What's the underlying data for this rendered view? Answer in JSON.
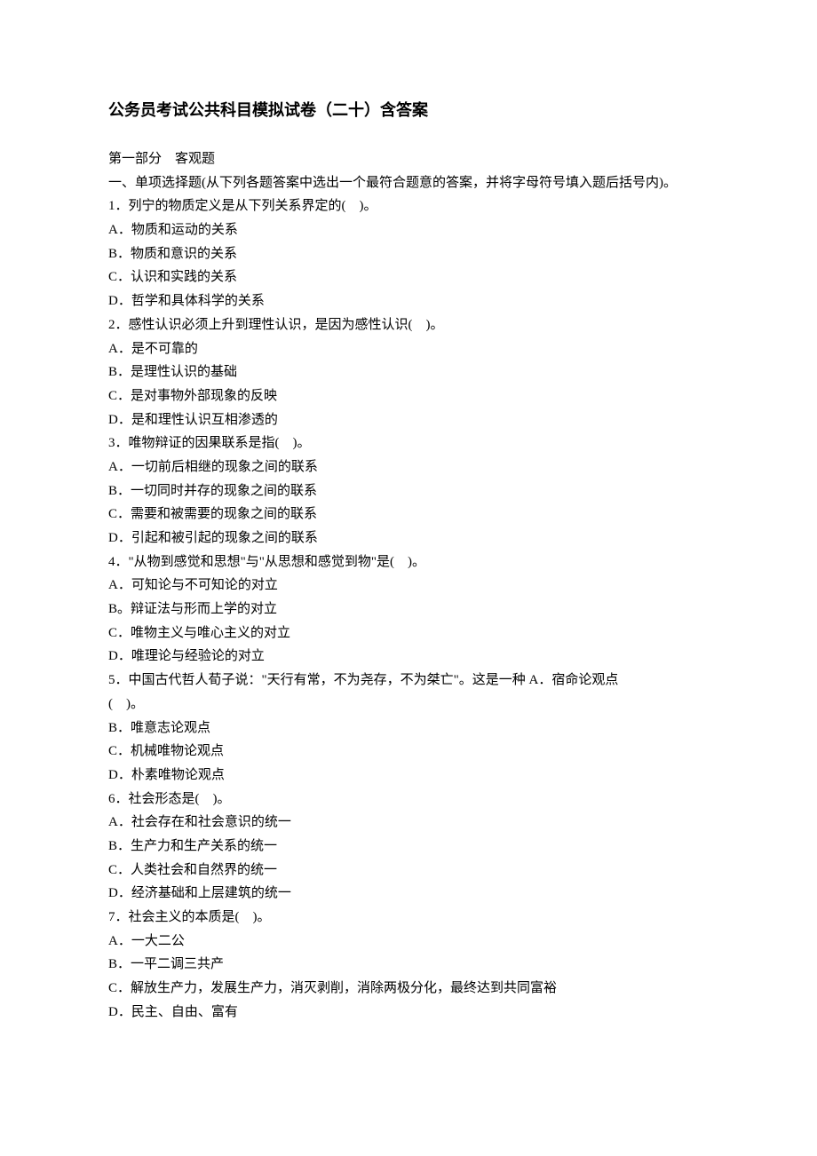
{
  "title": "公务员考试公共科目模拟试卷（二十）含答案",
  "subheading": "第一部分　客观题",
  "section_instruction": "一、单项选择题(从下列各题答案中选出一个最符合题意的答案，并将字母符号填入题后括号内)。",
  "questions": [
    {
      "stem": "1．列宁的物质定义是从下列关系界定的(　)。",
      "options": [
        "A．物质和运动的关系",
        "B．物质和意识的关系",
        "C．认识和实践的关系",
        "D．哲学和具体科学的关系"
      ]
    },
    {
      "stem": "2．感性认识必须上升到理性认识，是因为感性认识(　)。",
      "options": [
        "A．是不可靠的",
        "B．是理性认识的基础",
        "C．是对事物外部现象的反映",
        "D．是和理性认识互相渗透的"
      ]
    },
    {
      "stem": "3．唯物辩证的因果联系是指(　)。",
      "options": [
        "A．一切前后相继的现象之间的联系",
        "B．一切同时并存的现象之间的联系",
        "C．需要和被需要的现象之间的联系",
        "D．引起和被引起的现象之间的联系"
      ]
    },
    {
      "stem": "4．\"从物到感觉和思想\"与\"从思想和感觉到物\"是(　)。",
      "options": [
        "A．可知论与不可知论的对立",
        "B。辩证法与形而上学的对立",
        "C．唯物主义与唯心主义的对立",
        "D．唯理论与经验论的对立"
      ]
    },
    {
      "stem_line1": "5．中国古代哲人荀子说：\"天行有常，不为尧存，不为桀亡\"。这是一种 A．宿命论观点",
      "stem_line2": "(　)。",
      "options": [
        "B．唯意志论观点",
        "C．机械唯物论观点",
        "D．朴素唯物论观点"
      ]
    },
    {
      "stem": "6．社会形态是(　)。",
      "options": [
        "A．社会存在和社会意识的统一",
        "B．生产力和生产关系的统一",
        "C．人类社会和自然界的统一",
        "D．经济基础和上层建筑的统一"
      ]
    },
    {
      "stem": "7．社会主义的本质是(　)。",
      "options": [
        "A．一大二公",
        "B．一平二调三共产",
        "C．解放生产力，发展生产力，消灭剥削，消除两极分化，最终达到共同富裕",
        "D．民主、自由、富有"
      ]
    }
  ]
}
